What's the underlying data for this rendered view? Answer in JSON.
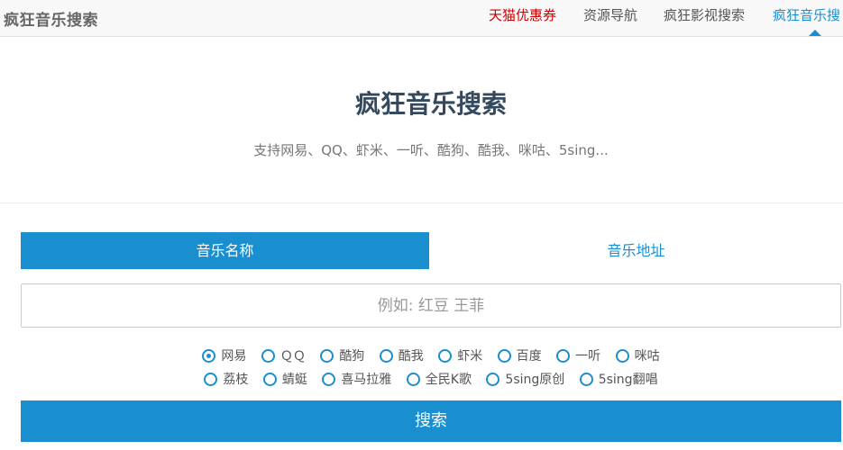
{
  "header": {
    "brand": "疯狂音乐搜索",
    "nav": [
      {
        "label": "天猫优惠券",
        "color": "#cc0000"
      },
      {
        "label": "资源导航"
      },
      {
        "label": "疯狂影视搜索"
      },
      {
        "label": "疯狂音乐搜",
        "active": true,
        "color": "#1a8fd0"
      }
    ]
  },
  "hero": {
    "title": "疯狂音乐搜索",
    "subtitle": "支持网易、QQ、虾米、一听、酷狗、酷我、咪咕、5sing..."
  },
  "tabs": [
    {
      "label": "音乐名称",
      "active": true
    },
    {
      "label": "音乐地址",
      "active": false
    }
  ],
  "search": {
    "placeholder": "例如: 红豆 王菲",
    "value": "",
    "button_label": "搜索"
  },
  "sources": {
    "selected": "网易",
    "row1": [
      "网易",
      "ＱＱ",
      "酷狗",
      "酷我",
      "虾米",
      "百度",
      "一听",
      "咪咕"
    ],
    "row2": [
      "荔枝",
      "蜻蜓",
      "喜马拉雅",
      "全民K歌",
      "5sing原创",
      "5sing翻唱"
    ]
  },
  "colors": {
    "accent": "#1a8fd0",
    "promo": "#cc0000"
  }
}
